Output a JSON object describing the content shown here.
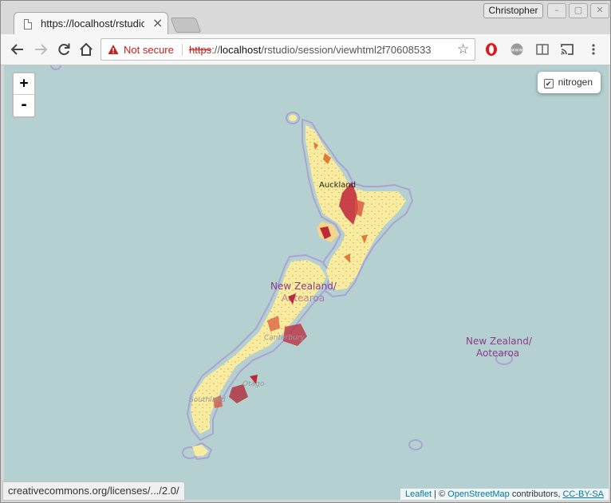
{
  "browser": {
    "tab_title": "https://localhost/rstudio",
    "tab_close": "×",
    "profile_name": "Christopher",
    "window_buttons": [
      "–",
      "▢",
      "✕"
    ]
  },
  "toolbar": {
    "back_icon": "arrow-left-icon",
    "forward_icon": "arrow-right-icon",
    "reload_icon": "reload-icon",
    "home_icon": "home-icon",
    "security_label": "Not secure",
    "url_scheme": "https",
    "url_sep": "://",
    "url_host": "localhost",
    "url_path": "/rstudio/session/viewhtml2f70608533",
    "bookmark_icon": "star-icon"
  },
  "map": {
    "zoom_in": "+",
    "zoom_out": "-",
    "layer_check": "✔",
    "layer_name": "nitrogen",
    "labels": {
      "auckland": "Auckland",
      "nz_main": "New Zealand/",
      "aotearoa_main": "Aotearoa",
      "nz_chatham": "New Zealand/",
      "aotearoa_chatham": "Aotearoa",
      "canterbury": "Canterbury",
      "otago": "Otago",
      "southland": "Southland"
    },
    "attribution": {
      "leaflet": "Leaflet",
      "sep": " | © ",
      "osm": "OpenStreetMap",
      "contributors": " contributors, ",
      "license": "CC-BY-SA"
    }
  },
  "status_url": "creativecommons.org/licenses/.../2.0/",
  "colors": {
    "sea": "#b5d0d0",
    "land_fill": "#f8eca0",
    "coast_outline": "#a9a3d0",
    "hot_spot": "#c0263a",
    "warm_spot": "#e07a3a",
    "not_secure": "#c5221f",
    "link": "#0078a8"
  }
}
